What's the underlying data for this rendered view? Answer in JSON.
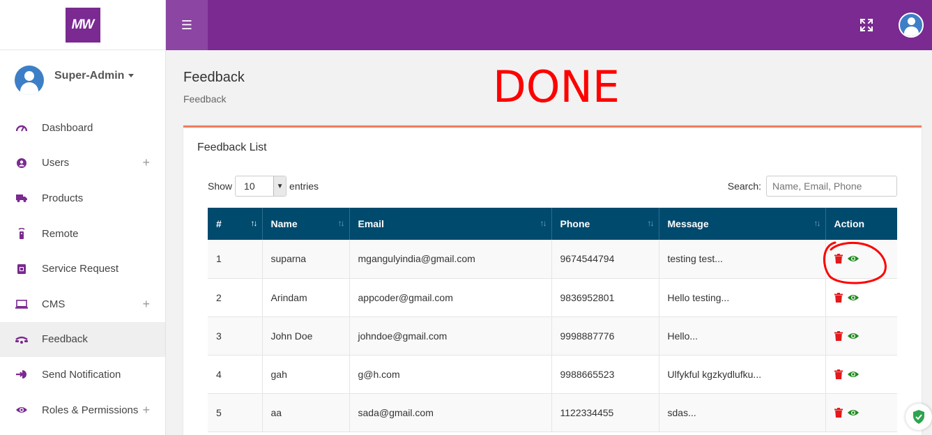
{
  "brand": {
    "logo_text": "MW"
  },
  "user": {
    "name": "Super-Admin"
  },
  "sidebar": {
    "items": [
      {
        "label": "Dashboard",
        "icon": "tachometer-icon",
        "expandable": false
      },
      {
        "label": "Users",
        "icon": "user-circle-icon",
        "expandable": true
      },
      {
        "label": "Products",
        "icon": "truck-icon",
        "expandable": false
      },
      {
        "label": "Remote",
        "icon": "remote-icon",
        "expandable": false
      },
      {
        "label": "Service Request",
        "icon": "clipboard-icon",
        "expandable": false
      },
      {
        "label": "CMS",
        "icon": "laptop-icon",
        "expandable": true
      },
      {
        "label": "Feedback",
        "icon": "feedback-icon",
        "expandable": false,
        "active": true
      },
      {
        "label": "Send Notification",
        "icon": "sign-in-icon",
        "expandable": false
      },
      {
        "label": "Roles & Permissions",
        "icon": "eye-icon",
        "expandable": true
      }
    ],
    "plus_symbol": "+"
  },
  "topbar": {
    "menu_symbol": "☰"
  },
  "page": {
    "title": "Feedback",
    "breadcrumb": "Feedback",
    "annotation_done": "DONE"
  },
  "card": {
    "title": "Feedback List",
    "show_label": "Show",
    "entries_value": "10",
    "entries_label": "entries",
    "search_label": "Search:",
    "search_placeholder": "Name, Email, Phone"
  },
  "table": {
    "headers": [
      "#",
      "Name",
      "Email",
      "Phone",
      "Message",
      "Action"
    ],
    "rows": [
      {
        "num": "1",
        "name": "suparna",
        "email": "mgangulyindia@gmail.com",
        "phone": "9674544794",
        "message": "testing test..."
      },
      {
        "num": "2",
        "name": "Arindam",
        "email": "appcoder@gmail.com",
        "phone": "9836952801",
        "message": "Hello testing..."
      },
      {
        "num": "3",
        "name": "John Doe",
        "email": "johndoe@gmail.com",
        "phone": "9998887776",
        "message": "Hello..."
      },
      {
        "num": "4",
        "name": "gah",
        "email": "g@h.com",
        "phone": "9988665523",
        "message": "Ulfykful kgzkydlufku..."
      },
      {
        "num": "5",
        "name": "aa",
        "email": "sada@gmail.com",
        "phone": "1122334455",
        "message": "sdas..."
      }
    ]
  },
  "colors": {
    "brand_purple": "#7a2a90",
    "header_blue": "#004a6e",
    "card_accent": "#f07b5e",
    "delete_red": "#e3191c",
    "view_green": "#1e8a1e",
    "annotation_red": "#ff0000"
  }
}
